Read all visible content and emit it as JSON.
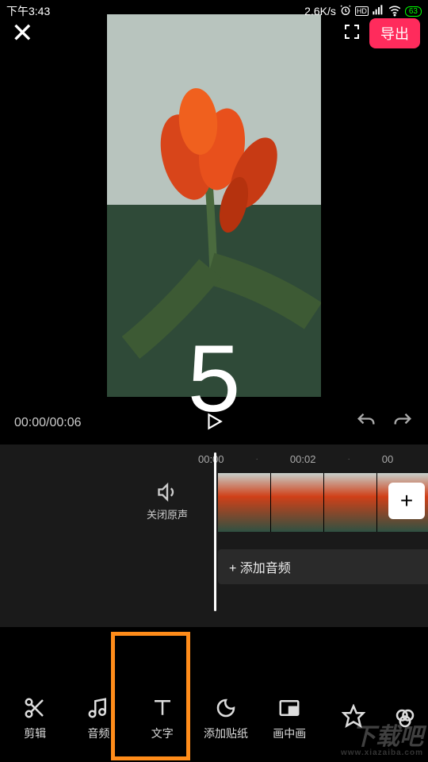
{
  "status": {
    "time": "下午3:43",
    "network_speed": "2.6K/s",
    "battery": "63"
  },
  "topbar": {
    "export_label": "导出"
  },
  "preview": {
    "countdown": "5"
  },
  "controls": {
    "current_time": "00:00",
    "total_time": "00:06"
  },
  "timeline": {
    "ruler": [
      "00:00",
      "·",
      "00:02",
      "·",
      "00"
    ],
    "mute_label": "关闭原声",
    "add_audio_label": "+  添加音频"
  },
  "toolbar": {
    "items": [
      {
        "name": "edit",
        "label": "剪辑"
      },
      {
        "name": "audio",
        "label": "音频"
      },
      {
        "name": "text",
        "label": "文字"
      },
      {
        "name": "sticker",
        "label": "添加贴纸"
      },
      {
        "name": "pip",
        "label": "画中画"
      },
      {
        "name": "effect",
        "label": ""
      }
    ]
  },
  "watermark": {
    "main": "下载吧",
    "sub": "www.xiazaiba.com"
  }
}
